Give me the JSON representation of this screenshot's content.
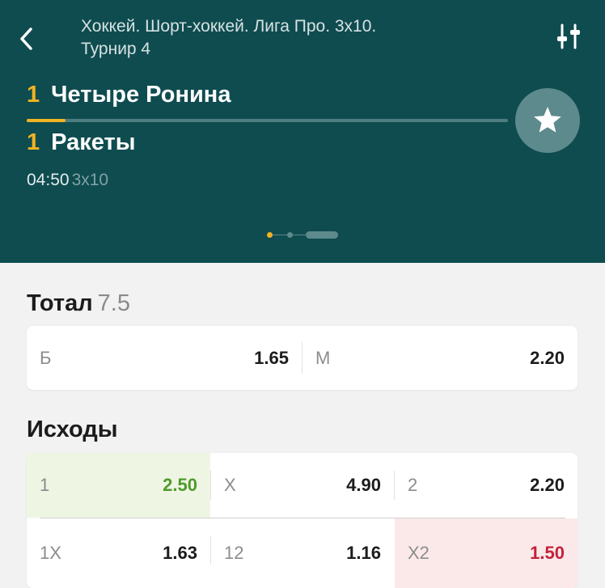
{
  "header": {
    "title": "Хоккей. Шорт-хоккей. Лига Про. 3х10.\nТурнир 4",
    "back_icon": "chevron-left-icon",
    "filter_icon": "sliders-icon",
    "favorite_icon": "star-icon",
    "accent_color": "#f0b323",
    "background_color": "#0f4c50"
  },
  "match": {
    "team1": {
      "score": "1",
      "name": "Четыре Ронина"
    },
    "team2": {
      "score": "1",
      "name": "Ракеты"
    },
    "clock": "04:50",
    "format": "3х10",
    "progress": 0.08
  },
  "pager": {
    "pages": 3,
    "active": 0
  },
  "total": {
    "title": "Тотал",
    "line": "7.5",
    "odds": [
      {
        "label": "Б",
        "value": "1.65"
      },
      {
        "label": "М",
        "value": "2.20"
      }
    ]
  },
  "outcomes": {
    "title": "Исходы",
    "row1": [
      {
        "label": "1",
        "value": "2.50",
        "state": "up"
      },
      {
        "label": "X",
        "value": "4.90",
        "state": "none"
      },
      {
        "label": "2",
        "value": "2.20",
        "state": "none"
      }
    ],
    "row2": [
      {
        "label": "1X",
        "value": "1.63",
        "state": "none"
      },
      {
        "label": "12",
        "value": "1.16",
        "state": "none"
      },
      {
        "label": "X2",
        "value": "1.50",
        "state": "down"
      }
    ]
  }
}
